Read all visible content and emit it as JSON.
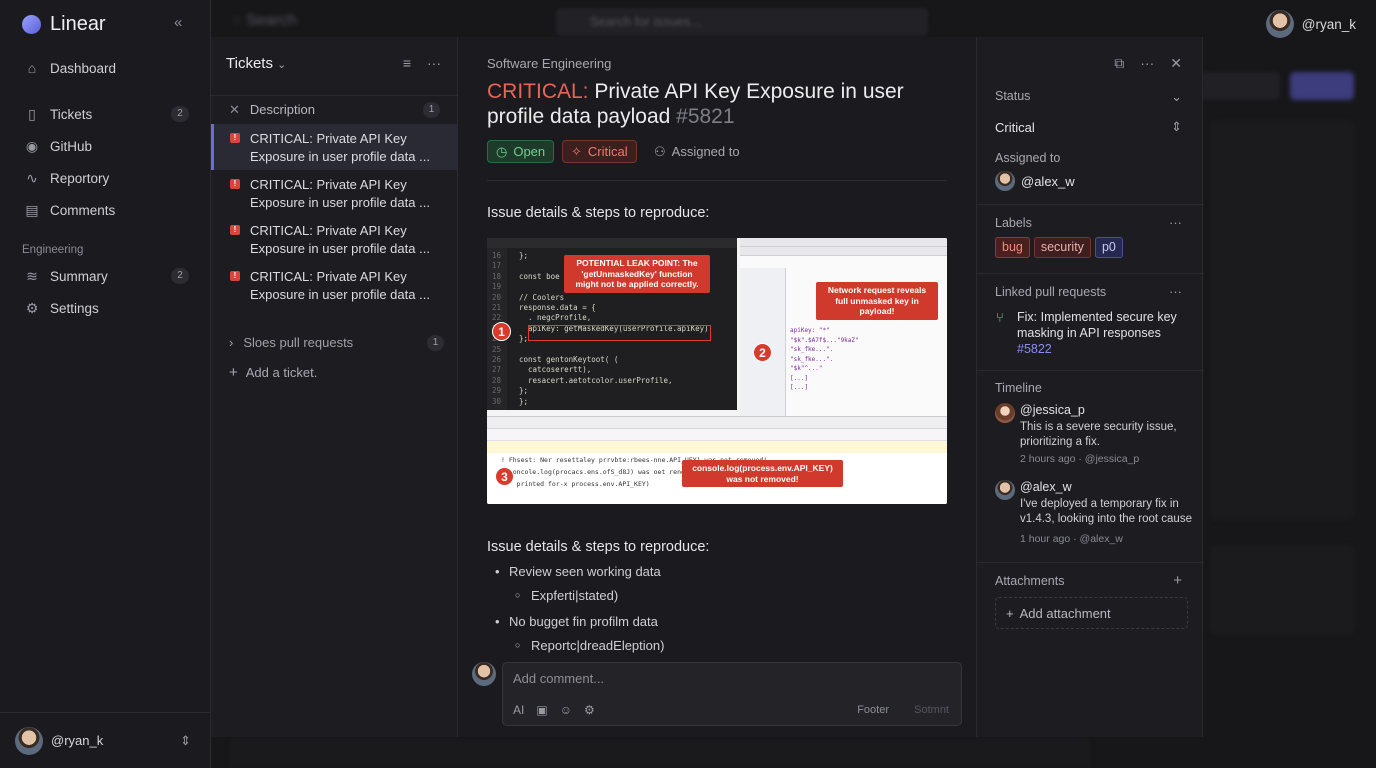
{
  "app": {
    "name": "Linear"
  },
  "top": {
    "search_label": "Search",
    "search_placeholder": "Search for issues...",
    "user": "@ryan_k"
  },
  "sidebar": {
    "items": [
      {
        "label": "Dashboard",
        "icon": "home-icon"
      },
      {
        "label": "Tickets",
        "icon": "ticket-icon",
        "count": "2"
      },
      {
        "label": "GitHub",
        "icon": "github-icon"
      },
      {
        "label": "Reportory",
        "icon": "pulse-icon"
      },
      {
        "label": "Comments",
        "icon": "comment-icon"
      }
    ],
    "section": "Engineering",
    "section_items": [
      {
        "label": "Summary",
        "icon": "stack-icon",
        "count": "2"
      },
      {
        "label": "Settings",
        "icon": "gear-icon"
      }
    ],
    "user": "@ryan_k"
  },
  "list": {
    "title": "Tickets",
    "description_label": "Description",
    "description_count": "1",
    "tickets": [
      {
        "line1": "CRITICAL: Private API Key",
        "line2": "Exposure in user profile data ..."
      },
      {
        "line1": "CRITICAL: Private API Key",
        "line2": "Exposure in user profile data ..."
      },
      {
        "line1": "CRITICAL: Private API Key",
        "line2": "Exposure in user profile data ..."
      },
      {
        "line1": "CRITICAL: Private API Key",
        "line2": "Exposure in user profile data ..."
      }
    ],
    "pr_label": "Sloes pull requests",
    "pr_count": "1",
    "add_label": "Add a ticket."
  },
  "issue": {
    "breadcrumb": "Software Engineering",
    "title_prefix": "CRITICAL:",
    "title_text": " Private API Key Exposure in user profile data payload ",
    "title_number": "#5821",
    "status_pill": "Open",
    "priority_pill": "Critical",
    "assigned_label": "Assigned to",
    "section1": "Issue details & steps to reproduce:",
    "section2": "Issue details & steps to reproduce:",
    "screenshot": {
      "callout1": "POTENTIAL LEAK POINT: The 'getUnmaskedKey' function might not be applied correctly.",
      "callout2": "Network request reveals full unmasked key in payload!",
      "callout3": "console.log(process.env.API_KEY) was not removed!",
      "n1": "1",
      "n2": "2",
      "n3": "3",
      "code_lines": "};\n\nconst boe\n\n// Coolers\nresponse.data = {\n  . negcProfile,\n  apiKey: getMaskedKey(userProfile.apiKey)\n};\n\nconst gentonKeytoot( (\n  catcoserertt),\n  resacert.aetotcolor.userProfile,\n};\n};",
      "gutter": "16\n17\n18\n19\n20\n21\n22\n23\n24\n25\n26\n27\n28\n29\n30",
      "net_rows": "apiKey: \"*\"\n\"$k\".$A7f$...\"9kaZ\"\n\"sk_fke...\".\n\"sk_fke...\".\n\"$k\"^...\"\n[...]\n[...]",
      "console_lines": "! Fhsest: Ner resettaley prrvbte:rbees-nne.API_UEY) was not removed!\n> concole.log(procacs.ens.ofS_d8J) was oet renesed!\n    printed for-x process.env.API_KEY)"
    },
    "steps": [
      {
        "text": "Review seen working data",
        "sub": false
      },
      {
        "text": "Expferti|stated)",
        "sub": true
      },
      {
        "text": "No bugget fin profilm data",
        "sub": false
      },
      {
        "text": "Reportc|dreadElеption)",
        "sub": true
      }
    ],
    "comment": {
      "placeholder": "Add comment...",
      "tool_ai": "AI",
      "footer": "Footer",
      "submit": "Sotmnt"
    }
  },
  "props": {
    "status_label": "Status",
    "status_value": "Critical",
    "assigned_label": "Assigned to",
    "assignee": "@alex_w",
    "labels_label": "Labels",
    "labels": [
      {
        "text": "bug"
      },
      {
        "text": "security"
      },
      {
        "text": "p0"
      }
    ],
    "linked_label": "Linked pull requests",
    "linked_text": "Fix: Implemented secure key masking in API responses",
    "linked_number": "#5822",
    "timeline_label": "Timeline",
    "timeline": [
      {
        "user": "@jessica_p",
        "text": "This is a severe security issue, prioritizing a fix.",
        "meta": "2 hours ago · @jessica_p"
      },
      {
        "user": "@alex_w",
        "text": "I've deployed a temporary fix in v1.4.3, looking into the root cause",
        "meta": "1 hour ago · @alex_w"
      }
    ],
    "attachments_label": "Attachments",
    "add_attachment": "Add attachment"
  },
  "colors": {
    "accent": "#6d6bd9",
    "critical": "#e86457",
    "open": "#6ed18f",
    "bg": "#17171a"
  }
}
